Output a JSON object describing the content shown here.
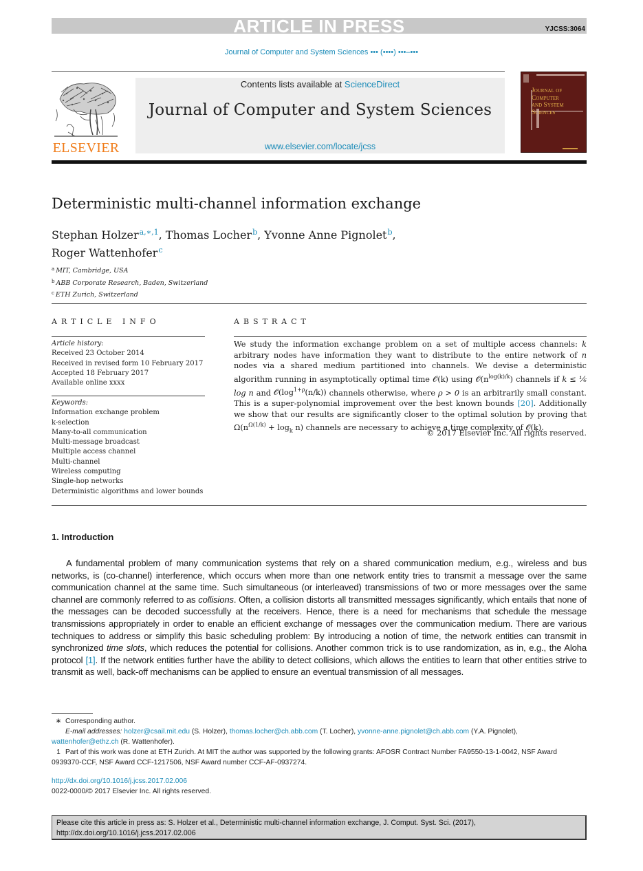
{
  "banner": {
    "status": "ARTICLE IN PRESS",
    "article_id": "YJCSS:3064",
    "journal_ref": "Journal of Computer and System Sciences ••• (••••) •••–•••"
  },
  "masthead": {
    "publisher": "ELSEVIER",
    "contents_prefix": "Contents lists available at ",
    "contents_link": "ScienceDirect",
    "journal_title": "Journal of Computer and System Sciences",
    "url": "www.elsevier.com/locate/jcss",
    "cover_title_lines": [
      "Journal of",
      "Computer",
      "and System",
      "Sciences"
    ]
  },
  "article": {
    "title": "Deterministic multi-channel information exchange",
    "authors": [
      {
        "name": "Stephan Holzer",
        "marks": "a,∗,1",
        "sep": ", "
      },
      {
        "name": "Thomas Locher",
        "marks": "b",
        "sep": ", "
      },
      {
        "name": "Yvonne Anne Pignolet",
        "marks": "b",
        "sep": ","
      },
      {
        "name": "Roger Wattenhofer",
        "marks": "c",
        "sep": ""
      }
    ],
    "affiliations": [
      {
        "mark": "a",
        "text": "MIT, Cambridge, USA"
      },
      {
        "mark": "b",
        "text": "ABB Corporate Research, Baden, Switzerland"
      },
      {
        "mark": "c",
        "text": "ETH Zurich, Switzerland"
      }
    ]
  },
  "article_info": {
    "heading": "ARTICLE INFO",
    "history_label": "Article history:",
    "history": [
      "Received 23 October 2014",
      "Received in revised form 10 February 2017",
      "Accepted 18 February 2017",
      "Available online xxxx"
    ],
    "keywords_label": "Keywords:",
    "keywords": [
      "Information exchange problem",
      "k-selection",
      "Many-to-all communication",
      "Multi-message broadcast",
      "Multiple access channel",
      "Multi-channel",
      "Wireless computing",
      "Single-hop networks",
      "Deterministic algorithms and lower bounds"
    ]
  },
  "abstract": {
    "heading": "ABSTRACT",
    "p1": "We study the information exchange problem on a set of multiple access channels: ",
    "k": "k",
    "p2": " arbitrary nodes have information they want to distribute to the entire network of ",
    "n": "n",
    "p3": " nodes via a shared medium partitioned into channels. We devise a deterministic algorithm running in asymptotically optimal time ",
    "m1": "𝒪(k)",
    "p4": " using ",
    "m2_base": "𝒪(n",
    "m2_sup": "log(k)/k",
    "m2_end": ")",
    "p5": " channels if ",
    "m3": "k ≤ ⅙ log n",
    "p6": " and ",
    "m4_base": "𝒪(log",
    "m4_sup": "1+ρ",
    "m4_end": "(n/k))",
    "p7": " channels otherwise, where ",
    "m5": "ρ > 0",
    "p8": " is an arbitrarily small constant. This is a super-polynomial improvement over the best known bounds ",
    "ref20": "[20]",
    "p9": ". Additionally we show that our results are significantly closer to the optimal solution by proving that ",
    "m6_base": "Ω(n",
    "m6_sup": "Ω(1/k)",
    "m6_mid": " + log",
    "m6_sub": "k",
    "m6_end": " n)",
    "p10": " channels are necessary to achieve a time complexity of ",
    "m7": "𝒪(k)",
    "p11": ".",
    "copyright": "© 2017 Elsevier Inc. All rights reserved."
  },
  "introduction": {
    "heading": "1.  Introduction",
    "t1": "A fundamental problem of many communication systems that rely on a shared communication medium, e.g., wireless and bus networks, is (co-channel) interference, which occurs when more than one network entity tries to transmit a message over the same communication channel at the same time. Such simultaneous (or interleaved) transmissions of two or more messages over the same channel are commonly referred to as ",
    "collisions": "collisions",
    "t2": ". Often, a collision distorts all transmitted messages significantly, which entails that none of the messages can be decoded successfully at the receivers. Hence, there is a need for mechanisms that schedule the message transmissions appropriately in order to enable an efficient exchange of messages over the communication medium. There are various techniques to address or simplify this basic scheduling problem: By introducing a notion of time, the network entities can transmit in synchronized ",
    "time_slots": "time slots",
    "t3": ", which reduces the potential for collisions. Another common trick is to use randomization, as in, e.g., the Aloha protocol ",
    "ref1": "[1]",
    "t4": ". If the network entities further have the ability to detect collisions, which allows the entities to learn that other entities strive to transmit as well, back-off mechanisms can be applied to ensure an eventual transmission of all messages."
  },
  "footnotes": {
    "corresponding_mark": "∗",
    "corresponding": "Corresponding author.",
    "email_label": "E-mail addresses:",
    "emails": [
      {
        "address": "holzer@csail.mit.edu",
        "who": " (S. Holzer), "
      },
      {
        "address": "thomas.locher@ch.abb.com",
        "who": " (T. Locher), "
      },
      {
        "address": "yvonne-anne.pignolet@ch.abb.com",
        "who": " (Y.A. Pignolet),"
      },
      {
        "address": "wattenhofer@ethz.ch",
        "who": " (R. Wattenhofer)."
      }
    ],
    "fn1_mark": "1",
    "fn1": "Part of this work was done at ETH Zurich. At MIT the author was supported by the following grants: AFOSR Contract Number FA9550-13-1-0042, NSF Award 0939370-CCF, NSF Award CCF-1217506, NSF Award number CCF-AF-0937274.",
    "doi": "http://dx.doi.org/10.1016/j.jcss.2017.02.006",
    "issn_copyright": "0022-0000/© 2017 Elsevier Inc. All rights reserved."
  },
  "cite_box": {
    "line1": "Please cite this article in press as: S. Holzer et al., Deterministic multi-channel information exchange, J. Comput. Syst. Sci. (2017),",
    "line2": "http://dx.doi.org/10.1016/j.jcss.2017.02.006"
  },
  "colors": {
    "link": "#1a8bb8",
    "elsevier_orange": "#f07d1b",
    "cover_background": "#5e1a16",
    "banner_gray": "#c8c8c8"
  }
}
